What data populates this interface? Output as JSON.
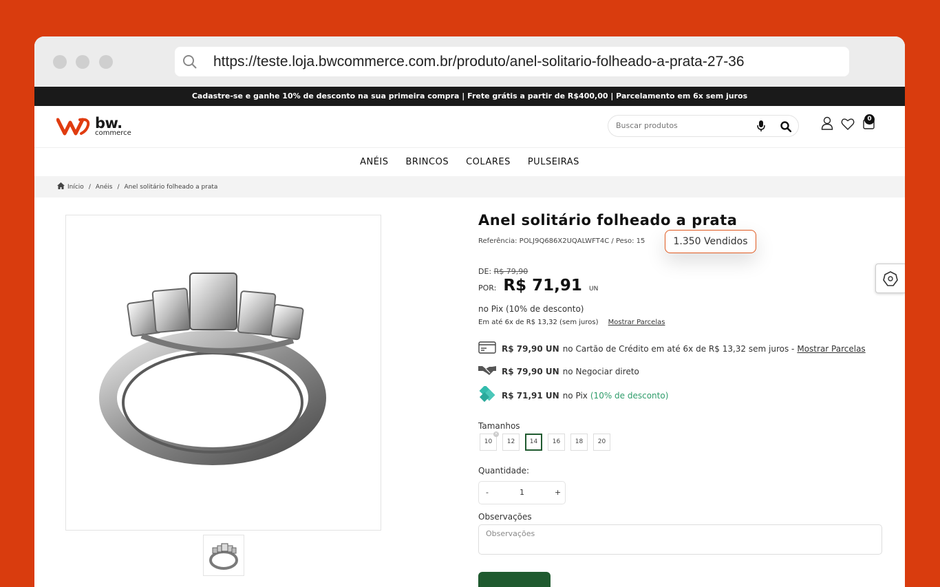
{
  "browser": {
    "url": "https://teste.loja.bwcommerce.com.br/produto/anel-solitario-folheado-a-prata-27-36"
  },
  "promo_bar": {
    "text": "Cadastre-se e ganhe 10% de desconto na sua primeira compra | Frete grátis a partir de R$400,00 | Parcelamento em 6x sem juros"
  },
  "header": {
    "logo_main": "bw.",
    "logo_sub": "commerce",
    "search_placeholder": "Buscar produtos",
    "cart_count": "0"
  },
  "nav": {
    "items": [
      "ANÉIS",
      "BRINCOS",
      "COLARES",
      "PULSEIRAS"
    ]
  },
  "breadcrumb": {
    "home": "Início",
    "category": "Anéis",
    "current": "Anel solitário folheado a prata"
  },
  "product": {
    "title": "Anel solitário folheado a prata",
    "reference": "Referência: POLJ9Q686X2UQALWFT4C  /  Peso: 15",
    "sold": "1.350 Vendidos",
    "old_price_label": "DE:",
    "old_price": "R$ 79,90",
    "new_price_label": "POR:",
    "new_price": "R$ 71,91",
    "unit": "UN",
    "pix_text": "no Pix (10% de desconto)",
    "installments_text": "Em até 6x de R$ 13,32 (sem juros)",
    "installments_link": "Mostrar Parcelas"
  },
  "payment_options": [
    {
      "price": "R$ 79,90 UN",
      "text": "no Cartão de Crédito em até 6x de R$ 13,32 sem juros -",
      "link": "Mostrar Parcelas",
      "extra": ""
    },
    {
      "price": "R$ 79,90 UN",
      "text": "no Negociar direto",
      "link": "",
      "extra": ""
    },
    {
      "price": "R$ 71,91 UN",
      "text": "no Pix",
      "link": "",
      "extra": "(10% de desconto)"
    }
  ],
  "sizes": {
    "label": "Tamanhos",
    "options": [
      "10",
      "12",
      "14",
      "16",
      "18",
      "20"
    ],
    "selected": "14",
    "unavailable": "10"
  },
  "quantity": {
    "label": "Quantidade:",
    "minus": "-",
    "value": "1",
    "plus": "+"
  },
  "notes": {
    "label": "Observações",
    "placeholder": "Observações"
  },
  "colors": {
    "background": "#d93c0e",
    "accent": "#e05a20",
    "buy_button": "#1f5a2f",
    "pix_green": "#2e9c6a"
  }
}
